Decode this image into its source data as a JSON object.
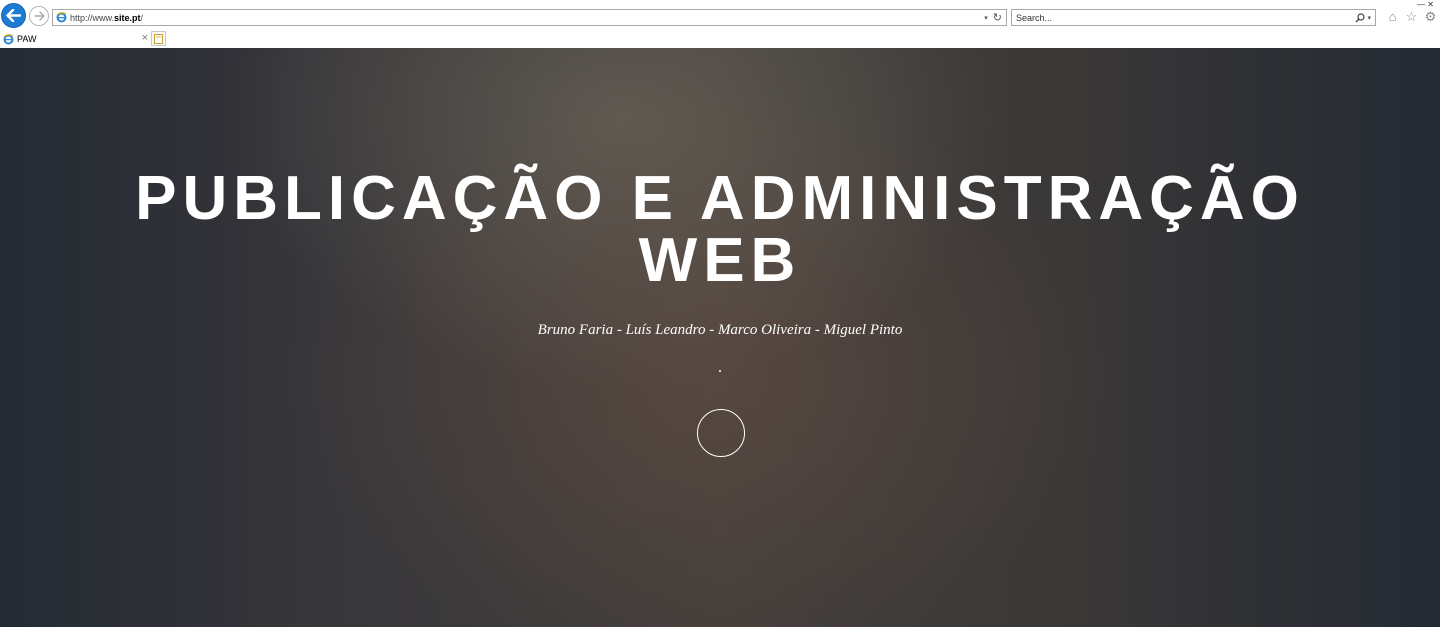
{
  "browser": {
    "url_prefix": "http://www.",
    "url_host": "site.pt",
    "url_suffix": "/",
    "search_placeholder": "Search...",
    "tab_title": "PAW",
    "address_dropdown": "▾",
    "search_icon_dropdown": "▾"
  },
  "page": {
    "title_line1": "PUBLICAÇÃO E ADMINISTRAÇÃO",
    "title_line2": "WEB",
    "authors": "Bruno Faria - Luís Leandro - Marco Oliveira - Miguel Pinto"
  },
  "colors": {
    "accent_blue": "#1e7bd4",
    "hero_text": "#ffffff"
  },
  "icons": [
    "back-arrow-icon",
    "forward-arrow-icon",
    "ie-page-icon",
    "refresh-icon",
    "search-icon",
    "home-icon",
    "star-icon",
    "gear-icon",
    "close-icon",
    "new-tab-icon"
  ]
}
